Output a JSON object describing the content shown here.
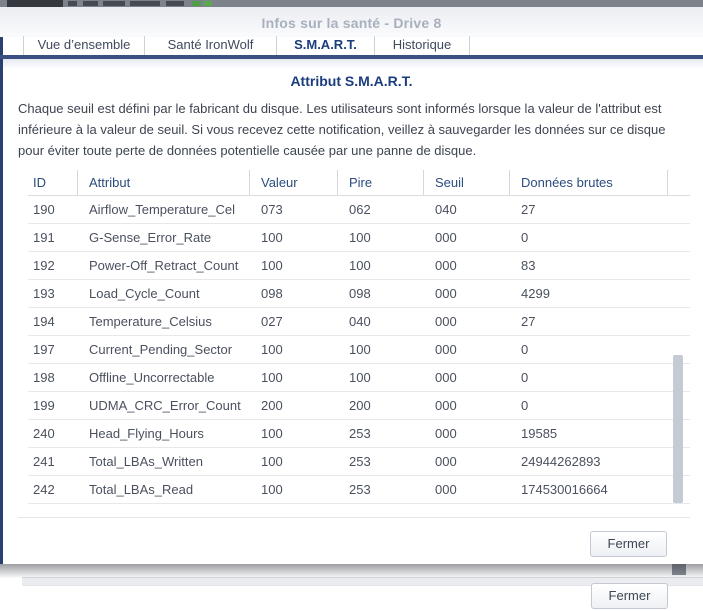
{
  "window": {
    "title": "Infos sur la santé - Drive 8"
  },
  "tabs": [
    {
      "label": "Vue d’ensemble",
      "active": false
    },
    {
      "label": "Santé IronWolf",
      "active": false
    },
    {
      "label": "S.M.A.R.T.",
      "active": true
    },
    {
      "label": "Historique",
      "active": false
    }
  ],
  "panel": {
    "heading": "Attribut S.M.A.R.T.",
    "description": "Chaque seuil est défini par le fabricant du disque. Les utilisateurs sont informés lorsque la valeur de l'attribut est inférieure à la valeur de seuil. Si vous recevez cette notification, veillez à sauvegarder les données sur ce disque pour éviter toute perte de données potentielle causée par une panne de disque."
  },
  "table": {
    "columns": [
      "ID",
      "Attribut",
      "Valeur",
      "Pire",
      "Seuil",
      "Données brutes"
    ],
    "rows": [
      [
        "190",
        "Airflow_Temperature_Cel",
        "073",
        "062",
        "040",
        "27"
      ],
      [
        "191",
        "G-Sense_Error_Rate",
        "100",
        "100",
        "000",
        "0"
      ],
      [
        "192",
        "Power-Off_Retract_Count",
        "100",
        "100",
        "000",
        "83"
      ],
      [
        "193",
        "Load_Cycle_Count",
        "098",
        "098",
        "000",
        "4299"
      ],
      [
        "194",
        "Temperature_Celsius",
        "027",
        "040",
        "000",
        "27"
      ],
      [
        "197",
        "Current_Pending_Sector",
        "100",
        "100",
        "000",
        "0"
      ],
      [
        "198",
        "Offline_Uncorrectable",
        "100",
        "100",
        "000",
        "0"
      ],
      [
        "199",
        "UDMA_CRC_Error_Count",
        "200",
        "200",
        "000",
        "0"
      ],
      [
        "240",
        "Head_Flying_Hours",
        "100",
        "253",
        "000",
        "19585"
      ],
      [
        "241",
        "Total_LBAs_Written",
        "100",
        "253",
        "000",
        "24944262893"
      ],
      [
        "242",
        "Total_LBAs_Read",
        "100",
        "253",
        "000",
        "174530016664"
      ]
    ]
  },
  "buttons": {
    "close_label": "Fermer"
  },
  "background_window": {
    "close_label": "Fermer"
  },
  "colors": {
    "accent_navy": "#3a5083",
    "active_tab": "#1c3d7d",
    "heading": "#1c3d7d",
    "title_text": "#a9b0bd",
    "body_text": "#3d4450",
    "table_header_text": "#2b4c7e",
    "cell_text": "#4a515e",
    "scrollbar_thumb": "#c5cbd4"
  }
}
